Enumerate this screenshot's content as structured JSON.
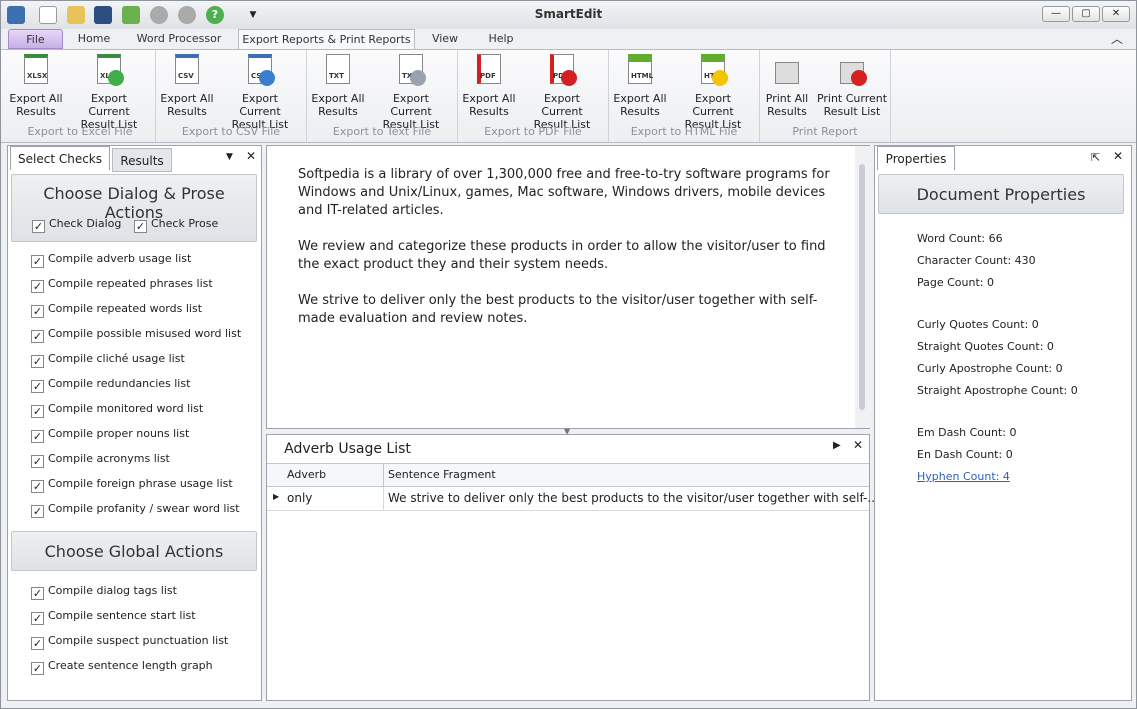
{
  "window": {
    "title": "SmartEdit"
  },
  "ribbon_tabs": [
    "File",
    "Home",
    "Word Processor",
    "Export Reports & Print Reports",
    "View",
    "Help"
  ],
  "groups": [
    {
      "label": "Export to Excel File",
      "buttons": [
        {
          "l1": "Export All",
          "l2": "Results",
          "tag": "XLSX"
        },
        {
          "l1": "Export Current",
          "l2": "Result List",
          "tag": "XLSX"
        }
      ]
    },
    {
      "label": "Export to CSV File",
      "buttons": [
        {
          "l1": "Export All",
          "l2": "Results",
          "tag": "CSV"
        },
        {
          "l1": "Export Current",
          "l2": "Result List",
          "tag": "CSV"
        }
      ]
    },
    {
      "label": "Export to Text File",
      "buttons": [
        {
          "l1": "Export All",
          "l2": "Results",
          "tag": "TXT"
        },
        {
          "l1": "Export Current",
          "l2": "Result List",
          "tag": "TXT"
        }
      ]
    },
    {
      "label": "Export to PDF File",
      "buttons": [
        {
          "l1": "Export All",
          "l2": "Results",
          "tag": "PDF"
        },
        {
          "l1": "Export Current",
          "l2": "Result List",
          "tag": "PDF"
        }
      ]
    },
    {
      "label": "Export to HTML File",
      "buttons": [
        {
          "l1": "Export All",
          "l2": "Results",
          "tag": "HTML"
        },
        {
          "l1": "Export Current",
          "l2": "Result List",
          "tag": "HTML"
        }
      ]
    },
    {
      "label": "Print Report",
      "buttons": [
        {
          "l1": "Print All",
          "l2": "Results",
          "tag": ""
        },
        {
          "l1": "Print Current",
          "l2": "Result List",
          "tag": ""
        }
      ]
    }
  ],
  "left_panel": {
    "tabs": [
      "Select Checks",
      "Results"
    ],
    "section1": {
      "title": "Choose Dialog & Prose Actions",
      "check_dialog": "Check Dialog",
      "check_prose": "Check Prose"
    },
    "checks1": [
      "Compile adverb usage list",
      "Compile repeated phrases list",
      "Compile repeated words list",
      "Compile possible misused word list",
      "Compile cliché usage list",
      "Compile redundancies list",
      "Compile monitored word list",
      "Compile proper nouns list",
      "Compile acronyms list",
      "Compile foreign phrase usage list",
      "Compile profanity / swear word list"
    ],
    "section2": {
      "title": "Choose Global Actions"
    },
    "checks2": [
      "Compile dialog tags list",
      "Compile sentence start list",
      "Compile suspect punctuation list",
      "Create sentence length graph"
    ]
  },
  "editor": {
    "paragraphs": [
      "Softpedia is a library of over 1,300,000 free and free-to-try software programs for Windows and Unix/Linux, games, Mac software, Windows drivers, mobile devices and IT-related articles.",
      "We review and categorize these products in order to allow the visitor/user to find the exact product they and their system needs.",
      "We strive to deliver only the best products to the visitor/user together with self-made evaluation and review notes."
    ]
  },
  "result_list": {
    "tab": "Adverb Usage List",
    "columns": [
      "Adverb",
      "Sentence Fragment"
    ],
    "rows": [
      {
        "adverb": "only",
        "fragment": "We strive to deliver only the best products to the visitor/user together with self-..."
      }
    ]
  },
  "properties": {
    "tab": "Properties",
    "title": "Document Properties",
    "items": [
      "Word Count: 66",
      "Character Count: 430",
      "Page Count: 0",
      "Curly Quotes Count: 0",
      "Straight Quotes Count: 0",
      "Curly Apostrophe Count: 0",
      "Straight Apostrophe Count: 0",
      "Em Dash Count: 0",
      "En Dash Count: 0",
      "Hyphen Count: 4"
    ]
  }
}
